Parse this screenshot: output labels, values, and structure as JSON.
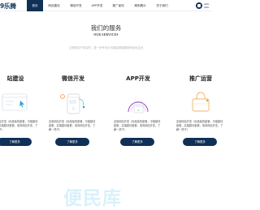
{
  "header": {
    "logo_text": "9乐腾",
    "nav": [
      {
        "label": "首页",
        "active": true
      },
      {
        "label": "网站建设"
      },
      {
        "label": "微信开发"
      },
      {
        "label": "APP开发"
      },
      {
        "label": "推广宣传"
      },
      {
        "label": "案例展示"
      },
      {
        "label": "关于我们"
      }
    ],
    "contact_line1": "400-",
    "contact_line2": "400-",
    "brand_color": "#0f3057"
  },
  "services_section": {
    "title": "我们的服务",
    "subtitle": "OUR SERVICES",
    "description": "立即您应于协议时，进一步专业中为提高网络服务商优化企业",
    "cards": [
      {
        "title": "站建设",
        "icon": "website-build-icon",
        "desc": "定制网站开发（标准版的套餐，中端模块套餐，高端模块套餐，电商网站开发，了解一揽子）",
        "button": "了解更多"
      },
      {
        "title": "微信开发",
        "icon": "wechat-dev-icon",
        "desc": "定制网站开发（标准版的套餐，中端模块套餐，高端模块套餐，电商网站开发，了解一揽子）",
        "button": "了解更多"
      },
      {
        "title": "APP开发",
        "icon": "app-dev-icon",
        "desc": "定制网站开发（标准版的套餐，中端模块套餐，高端模块套餐，电商网站开发，了解一揽子）",
        "button": "了解更多"
      },
      {
        "title": "推广运营",
        "icon": "marketing-icon",
        "desc": "定制网站开发（标准版的套餐，中端模块套餐，高端模块套餐，电商网站开发，了解一揽子）",
        "button": "了解更多"
      }
    ]
  },
  "watermark": "便民库"
}
